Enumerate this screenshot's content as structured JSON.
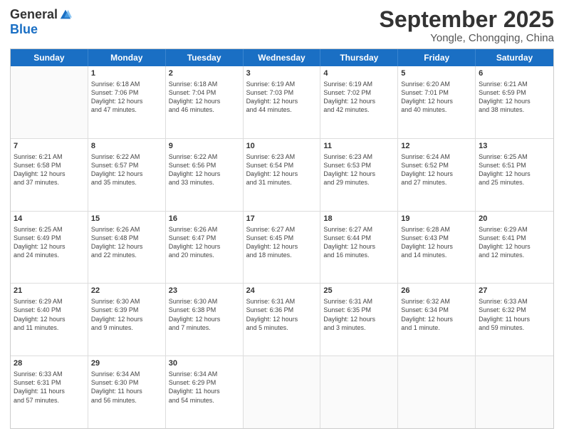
{
  "logo": {
    "general": "General",
    "blue": "Blue"
  },
  "title": "September 2025",
  "location": "Yongle, Chongqing, China",
  "days": [
    "Sunday",
    "Monday",
    "Tuesday",
    "Wednesday",
    "Thursday",
    "Friday",
    "Saturday"
  ],
  "weeks": [
    [
      {
        "day": "",
        "content": ""
      },
      {
        "day": "1",
        "content": "Sunrise: 6:18 AM\nSunset: 7:06 PM\nDaylight: 12 hours\nand 47 minutes."
      },
      {
        "day": "2",
        "content": "Sunrise: 6:18 AM\nSunset: 7:04 PM\nDaylight: 12 hours\nand 46 minutes."
      },
      {
        "day": "3",
        "content": "Sunrise: 6:19 AM\nSunset: 7:03 PM\nDaylight: 12 hours\nand 44 minutes."
      },
      {
        "day": "4",
        "content": "Sunrise: 6:19 AM\nSunset: 7:02 PM\nDaylight: 12 hours\nand 42 minutes."
      },
      {
        "day": "5",
        "content": "Sunrise: 6:20 AM\nSunset: 7:01 PM\nDaylight: 12 hours\nand 40 minutes."
      },
      {
        "day": "6",
        "content": "Sunrise: 6:21 AM\nSunset: 6:59 PM\nDaylight: 12 hours\nand 38 minutes."
      }
    ],
    [
      {
        "day": "7",
        "content": "Sunrise: 6:21 AM\nSunset: 6:58 PM\nDaylight: 12 hours\nand 37 minutes."
      },
      {
        "day": "8",
        "content": "Sunrise: 6:22 AM\nSunset: 6:57 PM\nDaylight: 12 hours\nand 35 minutes."
      },
      {
        "day": "9",
        "content": "Sunrise: 6:22 AM\nSunset: 6:56 PM\nDaylight: 12 hours\nand 33 minutes."
      },
      {
        "day": "10",
        "content": "Sunrise: 6:23 AM\nSunset: 6:54 PM\nDaylight: 12 hours\nand 31 minutes."
      },
      {
        "day": "11",
        "content": "Sunrise: 6:23 AM\nSunset: 6:53 PM\nDaylight: 12 hours\nand 29 minutes."
      },
      {
        "day": "12",
        "content": "Sunrise: 6:24 AM\nSunset: 6:52 PM\nDaylight: 12 hours\nand 27 minutes."
      },
      {
        "day": "13",
        "content": "Sunrise: 6:25 AM\nSunset: 6:51 PM\nDaylight: 12 hours\nand 25 minutes."
      }
    ],
    [
      {
        "day": "14",
        "content": "Sunrise: 6:25 AM\nSunset: 6:49 PM\nDaylight: 12 hours\nand 24 minutes."
      },
      {
        "day": "15",
        "content": "Sunrise: 6:26 AM\nSunset: 6:48 PM\nDaylight: 12 hours\nand 22 minutes."
      },
      {
        "day": "16",
        "content": "Sunrise: 6:26 AM\nSunset: 6:47 PM\nDaylight: 12 hours\nand 20 minutes."
      },
      {
        "day": "17",
        "content": "Sunrise: 6:27 AM\nSunset: 6:45 PM\nDaylight: 12 hours\nand 18 minutes."
      },
      {
        "day": "18",
        "content": "Sunrise: 6:27 AM\nSunset: 6:44 PM\nDaylight: 12 hours\nand 16 minutes."
      },
      {
        "day": "19",
        "content": "Sunrise: 6:28 AM\nSunset: 6:43 PM\nDaylight: 12 hours\nand 14 minutes."
      },
      {
        "day": "20",
        "content": "Sunrise: 6:29 AM\nSunset: 6:41 PM\nDaylight: 12 hours\nand 12 minutes."
      }
    ],
    [
      {
        "day": "21",
        "content": "Sunrise: 6:29 AM\nSunset: 6:40 PM\nDaylight: 12 hours\nand 11 minutes."
      },
      {
        "day": "22",
        "content": "Sunrise: 6:30 AM\nSunset: 6:39 PM\nDaylight: 12 hours\nand 9 minutes."
      },
      {
        "day": "23",
        "content": "Sunrise: 6:30 AM\nSunset: 6:38 PM\nDaylight: 12 hours\nand 7 minutes."
      },
      {
        "day": "24",
        "content": "Sunrise: 6:31 AM\nSunset: 6:36 PM\nDaylight: 12 hours\nand 5 minutes."
      },
      {
        "day": "25",
        "content": "Sunrise: 6:31 AM\nSunset: 6:35 PM\nDaylight: 12 hours\nand 3 minutes."
      },
      {
        "day": "26",
        "content": "Sunrise: 6:32 AM\nSunset: 6:34 PM\nDaylight: 12 hours\nand 1 minute."
      },
      {
        "day": "27",
        "content": "Sunrise: 6:33 AM\nSunset: 6:32 PM\nDaylight: 11 hours\nand 59 minutes."
      }
    ],
    [
      {
        "day": "28",
        "content": "Sunrise: 6:33 AM\nSunset: 6:31 PM\nDaylight: 11 hours\nand 57 minutes."
      },
      {
        "day": "29",
        "content": "Sunrise: 6:34 AM\nSunset: 6:30 PM\nDaylight: 11 hours\nand 56 minutes."
      },
      {
        "day": "30",
        "content": "Sunrise: 6:34 AM\nSunset: 6:29 PM\nDaylight: 11 hours\nand 54 minutes."
      },
      {
        "day": "",
        "content": ""
      },
      {
        "day": "",
        "content": ""
      },
      {
        "day": "",
        "content": ""
      },
      {
        "day": "",
        "content": ""
      }
    ]
  ]
}
